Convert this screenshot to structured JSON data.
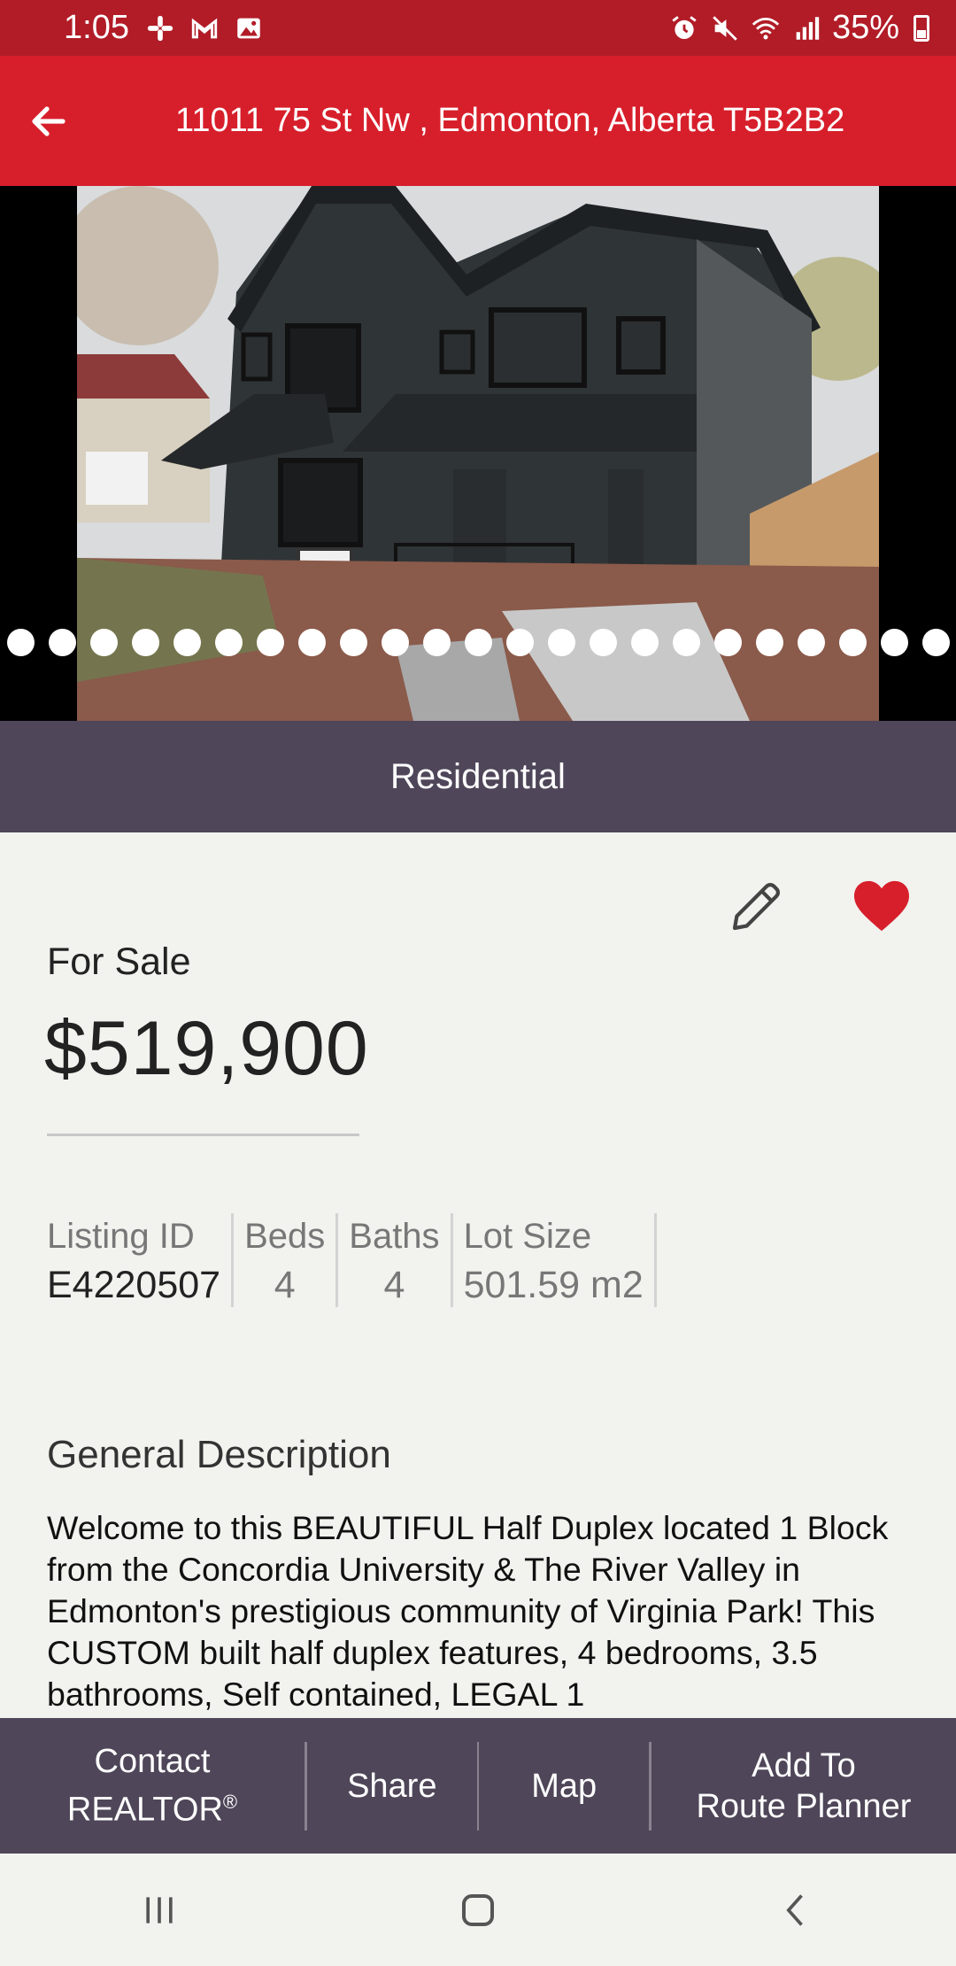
{
  "status_bar": {
    "time": "1:05",
    "battery": "35%"
  },
  "header": {
    "title": "11011 75 St Nw , Edmonton, Alberta T5B2B2"
  },
  "carousel": {
    "photo_count": 23,
    "current_index": 0
  },
  "property_type": "Residential",
  "listing": {
    "status": "For Sale",
    "price": "$519,900",
    "facts": [
      {
        "label": "Listing ID",
        "value": "E4220507"
      },
      {
        "label": "Beds",
        "value": "4"
      },
      {
        "label": "Baths",
        "value": "4"
      },
      {
        "label": "Lot Size",
        "value": "501.59 m2"
      }
    ],
    "favorited": true
  },
  "description": {
    "title": "General Description",
    "text": "Welcome to this BEAUTIFUL Half Duplex located 1 Block from the Concordia University & The River Valley in Edmonton's prestigious community of Virginia Park! This CUSTOM built half duplex features, 4 bedrooms, 3.5 bathrooms, Self contained, LEGAL 1"
  },
  "actions": {
    "contact_line1": "Contact",
    "contact_line2": "REALTOR",
    "contact_reg": "®",
    "share": "Share",
    "map": "Map",
    "route_line1": "Add To",
    "route_line2": "Route Planner"
  },
  "colors": {
    "status_bar": "#b11c27",
    "app_bar": "#d71f2b",
    "band": "#4f4659",
    "heart": "#d71f2b"
  }
}
